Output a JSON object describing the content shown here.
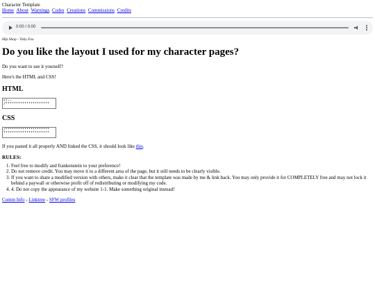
{
  "site_title": "Character Template",
  "nav": [
    {
      "label": "Home"
    },
    {
      "label": "About"
    },
    {
      "label": "Warnings"
    },
    {
      "label": "Codes"
    },
    {
      "label": "Creations"
    },
    {
      "label": "Commissions"
    },
    {
      "label": "Credits"
    }
  ],
  "player": {
    "time": "0:00 / 0:00"
  },
  "song_credit": "Hip Shop - Toby Fox",
  "heading": "Do you like the layout I used for my character pages?",
  "intro_1": "Do you want to use it yourself?",
  "intro_2": "Here's the HTML and CSS!",
  "html_section": {
    "title": "HTML",
    "code": "<!--\n/*********************"
  },
  "css_section": {
    "title": "CSS",
    "code": "/*********************\n**********************"
  },
  "preview_note": {
    "before": "If you pasted it all properly AND linked the CSS, it should look like ",
    "link": "this",
    "after": "."
  },
  "rules_title": "RULES:",
  "rules": [
    "Feel free to modify and frankenstein to your preference!",
    "Do not remove credit. You may move it to a different area of the page, but it still needs to be clearly visible.",
    "If you want to share a modified version with others, make it clear that the template was made by me & link back. You may only provide it for COMPLETELY free and may not lock it behind a paywall or otherwise profit off of redistributing or modifying my code.",
    "4. Do not copy the appearance of my website 1-1. Make something original instead!"
  ],
  "footer": {
    "link1": "Comm Info",
    "sep1": " - ",
    "link2": "Linktree",
    "sep2": " - ",
    "link3": "SFW profiles"
  }
}
